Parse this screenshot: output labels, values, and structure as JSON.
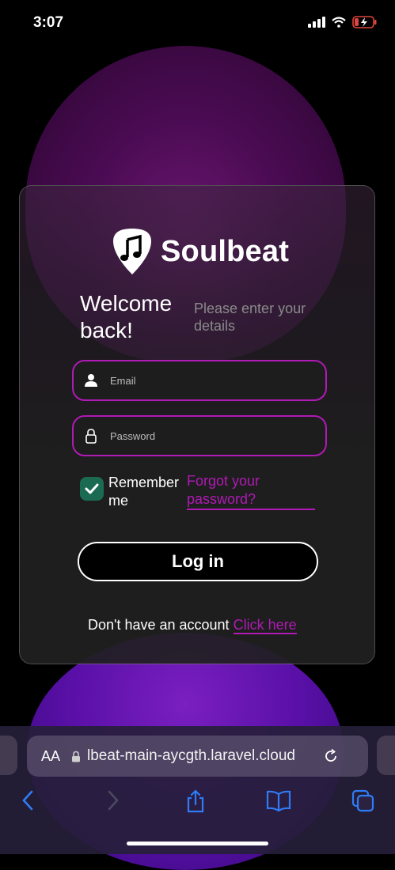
{
  "status_bar": {
    "time": "3:07"
  },
  "brand": {
    "name": "Soulbeat"
  },
  "login": {
    "welcome": "Welcome back!",
    "subtitle": "Please enter your details",
    "email_placeholder": "Email",
    "password_placeholder": "Password",
    "remember_label": "Remember me",
    "remember_checked": true,
    "forgot_label": "Forgot your password?",
    "login_button": "Log in",
    "signup_prompt": "Don't have an account",
    "signup_link": "Click here"
  },
  "browser": {
    "text_size_label": "AA",
    "url": "lbeat-main-aycgth.laravel.cloud"
  },
  "colors": {
    "accent": "#b01ab5",
    "checkbox": "#1a6b52",
    "link_blue": "#2f7cf6"
  }
}
